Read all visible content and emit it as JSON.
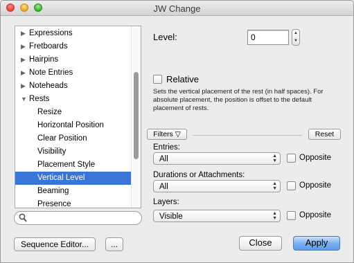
{
  "window": {
    "title": "JW Change"
  },
  "tree": {
    "items": [
      {
        "label": "Expressions",
        "type": "collapsed"
      },
      {
        "label": "Fretboards",
        "type": "collapsed"
      },
      {
        "label": "Hairpins",
        "type": "collapsed"
      },
      {
        "label": "Note Entries",
        "type": "collapsed"
      },
      {
        "label": "Noteheads",
        "type": "collapsed"
      },
      {
        "label": "Rests",
        "type": "expanded"
      },
      {
        "label": "Resize",
        "type": "child"
      },
      {
        "label": "Horizontal Position",
        "type": "child"
      },
      {
        "label": "Clear Position",
        "type": "child"
      },
      {
        "label": "Visibility",
        "type": "child"
      },
      {
        "label": "Placement Style",
        "type": "child"
      },
      {
        "label": "Vertical Level",
        "type": "child",
        "selected": true
      },
      {
        "label": "Beaming",
        "type": "child"
      },
      {
        "label": "Presence",
        "type": "child"
      }
    ]
  },
  "search": {
    "value": ""
  },
  "buttons": {
    "sequence_editor": "Sequence Editor...",
    "more": "...",
    "close": "Close",
    "apply": "Apply",
    "filters": "Filters ▽",
    "reset": "Reset"
  },
  "level": {
    "label": "Level:",
    "value": "0"
  },
  "relative": {
    "label": "Relative",
    "description": "Sets the vertical placement of the rest (in half spaces). For absolute placement, the position is offset to the default placement of rests."
  },
  "filters": {
    "entries": {
      "label": "Entries:",
      "value": "All",
      "opposite": "Opposite"
    },
    "durations": {
      "label": "Durations or Attachments:",
      "value": "All",
      "opposite": "Opposite"
    },
    "layers": {
      "label": "Layers:",
      "value": "Visible",
      "opposite": "Opposite"
    }
  }
}
